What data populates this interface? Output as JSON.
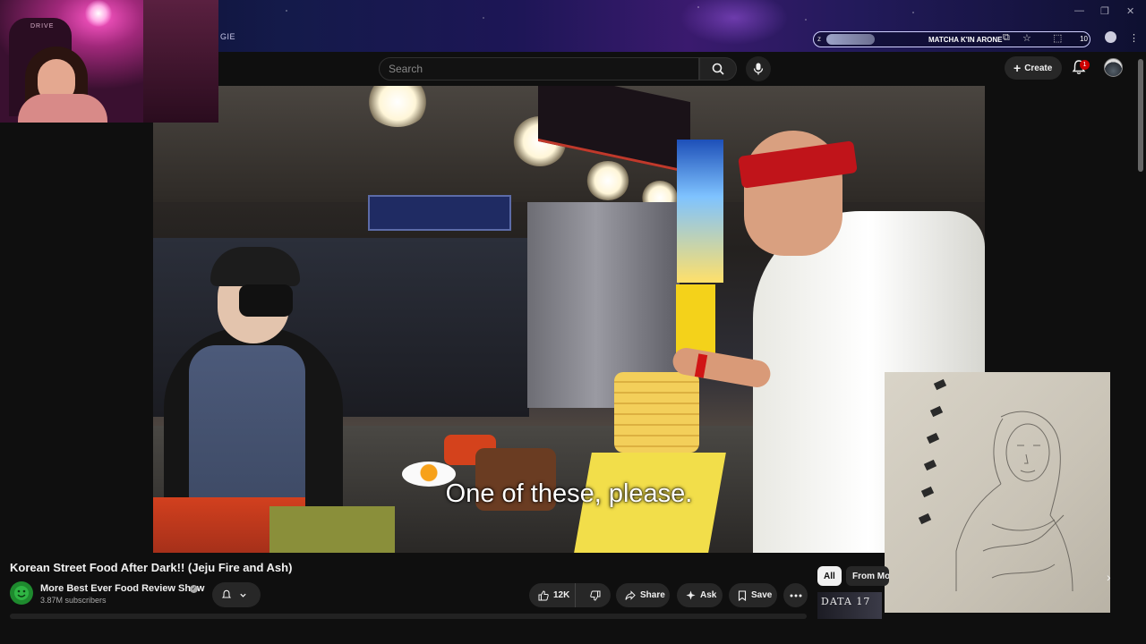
{
  "browser": {
    "tab_label": "GIE",
    "omnibox_prefix": "z",
    "omnibox_page": "MATCHA K'IN ARONE",
    "omnibox_count": "10",
    "window_controls": [
      "—",
      "❐",
      "✕"
    ]
  },
  "header": {
    "search_placeholder": "Search",
    "create_label": "Create",
    "notification_count": "1"
  },
  "webcam": {
    "label": "DRIVE"
  },
  "video": {
    "subtitle": "One of these, please.",
    "title": "Korean Street Food After Dark!! (Jeju Fire and Ash)"
  },
  "channel": {
    "name": "More Best Ever Food Review Show",
    "subscribers": "3.87M subscribers"
  },
  "actions": {
    "likes": "12K",
    "share_label": "Share",
    "ask_label": "Ask",
    "save_label": "Save"
  },
  "related": {
    "chips": [
      "All",
      "From More"
    ],
    "thumb_text": "DATA 17"
  },
  "colors": {
    "background": "#0f0f0f",
    "pill": "#272727",
    "badge": "#cc0000",
    "channel_avatar": "#1e8a2e"
  }
}
